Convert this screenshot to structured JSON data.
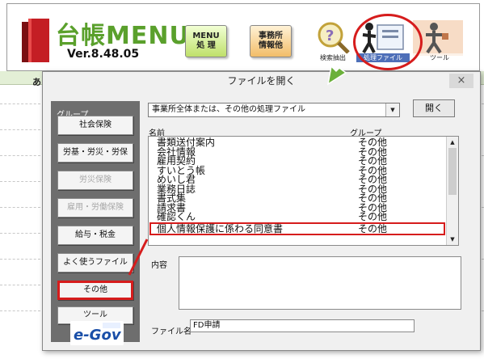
{
  "app": {
    "title": "台帳MENU",
    "version": "Ver.8.48.05"
  },
  "toolbar": {
    "menu_button": "MENU\n処 理",
    "office_button": "事務所\n情報他",
    "search_label": "検索抽出",
    "file_label": "処理ファイル",
    "tool_label": "ツール"
  },
  "sheet": {
    "column_letter": "あ"
  },
  "dialog": {
    "title": "ファイルを開く",
    "close_label": "×",
    "group_label": "グループ",
    "groups": [
      {
        "label": "社会保険",
        "state": "normal"
      },
      {
        "label": "労基・労災・労保",
        "state": "normal"
      },
      {
        "label": "労災保険",
        "state": "disabled"
      },
      {
        "label": "雇用・労働保険",
        "state": "disabled"
      },
      {
        "label": "給与・税金",
        "state": "normal"
      },
      {
        "label": "よく使うファイル",
        "state": "normal"
      },
      {
        "label": "その他",
        "state": "selected"
      },
      {
        "label": "ツール",
        "state": "normal"
      }
    ],
    "category_value": "事業所全体または、その他の処理ファイル",
    "open_button": "開く",
    "column_name": "名前",
    "column_group": "グループ",
    "files": [
      {
        "name": "書類送付案内",
        "group": "その他"
      },
      {
        "name": "会社情報",
        "group": "その他"
      },
      {
        "name": "雇用契約",
        "group": "その他"
      },
      {
        "name": "すいとう帳",
        "group": "その他"
      },
      {
        "name": "めいし君",
        "group": "その他"
      },
      {
        "name": "業務日誌",
        "group": "その他"
      },
      {
        "name": "書式集",
        "group": "その他"
      },
      {
        "name": "請求書",
        "group": "その他"
      },
      {
        "name": "確認くん",
        "group": "その他"
      },
      {
        "name": "個人情報保護に係わる同意書",
        "group": "その他"
      }
    ],
    "highlighted_index": 9,
    "content_label": "内容",
    "filename_label": "ファイル名",
    "filename_value": "FD申請"
  },
  "colors": {
    "accent_red": "#d61c1c",
    "title_green": "#5aa02c",
    "group_panel": "#6e6e6e",
    "arrow_green": "#6bb03a"
  },
  "icons": [
    "book-logo-icon",
    "magnifier-icon",
    "file-figure-icon",
    "tool-figure-icon",
    "green-arrow-icon",
    "egov-logo"
  ]
}
